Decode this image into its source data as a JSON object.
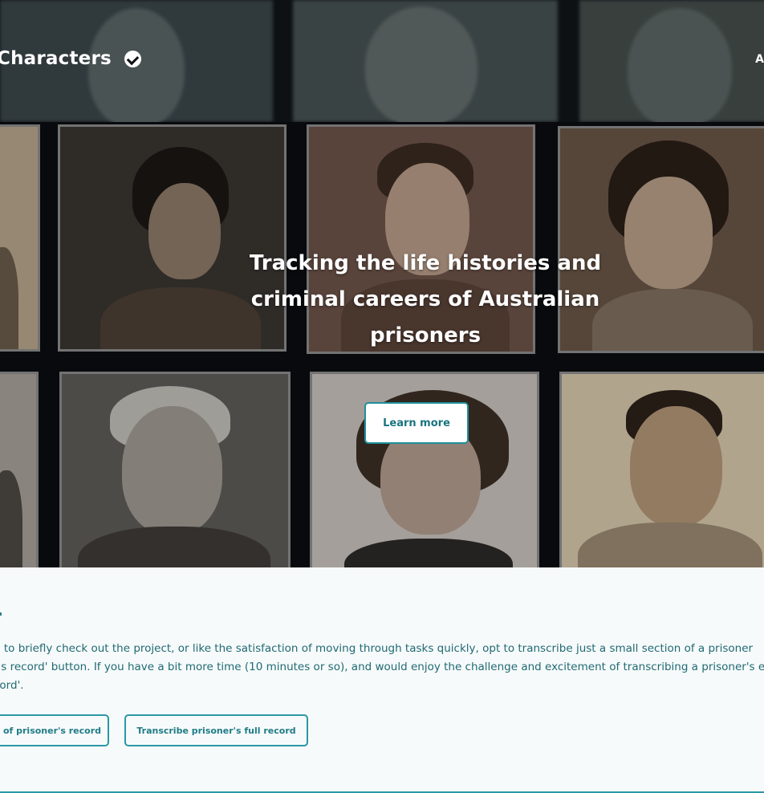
{
  "header": {
    "site_title": "Characters",
    "nav_partial": "A",
    "verified_icon": "check-circle-icon"
  },
  "hero": {
    "headline": "Tracking the life histories and criminal careers of Australian prisoners",
    "headline_lines": [
      "Tracking the life histories and",
      "criminal careers of Australian",
      "prisoners"
    ],
    "learn_more_label": "Learn more"
  },
  "intro": {
    "heading_fragment": ".",
    "lines": [
      "g to briefly check out the project, or like the satisfaction of moving through tasks quickly, opt to transcribe just a small section of a prisoner",
      "r's record' button. If you have a bit more time (10 minutes or so), and would enjoy the challenge and excitement of transcribing a prisoner's e",
      "cord'."
    ]
  },
  "actions": {
    "section_label": "of prisoner's record",
    "full_record_label": "Transcribe prisoner's full record"
  },
  "colors": {
    "accent": "#2a98a4",
    "text_teal": "#1f6a74",
    "header_bg": "#0d1114",
    "page_bg": "#f7fafa"
  }
}
